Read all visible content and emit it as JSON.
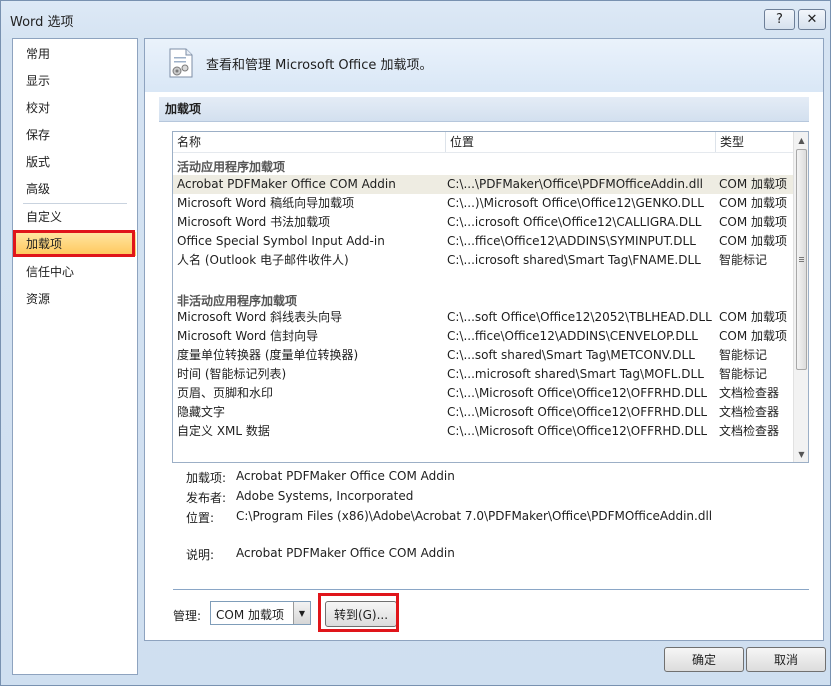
{
  "window": {
    "title": "Word 选项",
    "help_glyph": "?",
    "close_glyph": "✕"
  },
  "nav": {
    "items": [
      {
        "label": "常用"
      },
      {
        "label": "显示"
      },
      {
        "label": "校对"
      },
      {
        "label": "保存"
      },
      {
        "label": "版式"
      },
      {
        "label": "高级"
      },
      {
        "label": "自定义"
      },
      {
        "label": "加载项",
        "selected": true
      },
      {
        "label": "信任中心"
      },
      {
        "label": "资源"
      }
    ]
  },
  "header": {
    "text": "查看和管理 Microsoft Office 加载项。",
    "icon": "addins-document-icon"
  },
  "section": {
    "title": "加载项"
  },
  "table": {
    "columns": [
      "名称",
      "位置",
      "类型"
    ],
    "active_group": "活动应用程序加载项",
    "inactive_group": "非活动应用程序加载项",
    "active_rows": [
      [
        "Acrobat PDFMaker Office COM Addin",
        "C:\\...\\PDFMaker\\Office\\PDFMOfficeAddin.dll",
        "COM 加载项"
      ],
      [
        "Microsoft Word 稿纸向导加载项",
        "C:\\...)\\Microsoft Office\\Office12\\GENKO.DLL",
        "COM 加载项"
      ],
      [
        "Microsoft Word 书法加载项",
        "C:\\...icrosoft Office\\Office12\\CALLIGRA.DLL",
        "COM 加载项"
      ],
      [
        "Office Special Symbol Input Add-in",
        "C:\\...ffice\\Office12\\ADDINS\\SYMINPUT.DLL",
        "COM 加载项"
      ],
      [
        "人名 (Outlook 电子邮件收件人)",
        "C:\\...icrosoft shared\\Smart Tag\\FNAME.DLL",
        "智能标记"
      ]
    ],
    "inactive_rows": [
      [
        "Microsoft Word 斜线表头向导",
        "C:\\...soft Office\\Office12\\2052\\TBLHEAD.DLL",
        "COM 加载项"
      ],
      [
        "Microsoft Word 信封向导",
        "C:\\...ffice\\Office12\\ADDINS\\CENVELOP.DLL",
        "COM 加载项"
      ],
      [
        "度量单位转换器 (度量单位转换器)",
        "C:\\...soft shared\\Smart Tag\\METCONV.DLL",
        "智能标记"
      ],
      [
        "时间 (智能标记列表)",
        "C:\\...microsoft shared\\Smart Tag\\MOFL.DLL",
        "智能标记"
      ],
      [
        "页眉、页脚和水印",
        "C:\\...\\Microsoft Office\\Office12\\OFFRHD.DLL",
        "文档检查器"
      ],
      [
        "隐藏文字",
        "C:\\...\\Microsoft Office\\Office12\\OFFRHD.DLL",
        "文档检查器"
      ],
      [
        "自定义 XML 数据",
        "C:\\...\\Microsoft Office\\Office12\\OFFRHD.DLL",
        "文档检查器"
      ]
    ],
    "selected_row": 0
  },
  "details": {
    "addin_label": "加载项:",
    "addin_value": "Acrobat PDFMaker Office COM Addin",
    "publisher_label": "发布者:",
    "publisher_value": "Adobe Systems, Incorporated",
    "location_label": "位置:",
    "location_value": "C:\\Program Files (x86)\\Adobe\\Acrobat 7.0\\PDFMaker\\Office\\PDFMOfficeAddin.dll",
    "description_label": "说明:",
    "description_value": "Acrobat PDFMaker Office COM Addin"
  },
  "manage": {
    "label": "管理:",
    "selected_option": "COM 加载项",
    "go_button": "转到(G)..."
  },
  "buttons": {
    "ok": "确定",
    "cancel": "取消"
  },
  "colors": {
    "highlight_box": "#e0151a",
    "nav_selected": "#ffc65a"
  }
}
